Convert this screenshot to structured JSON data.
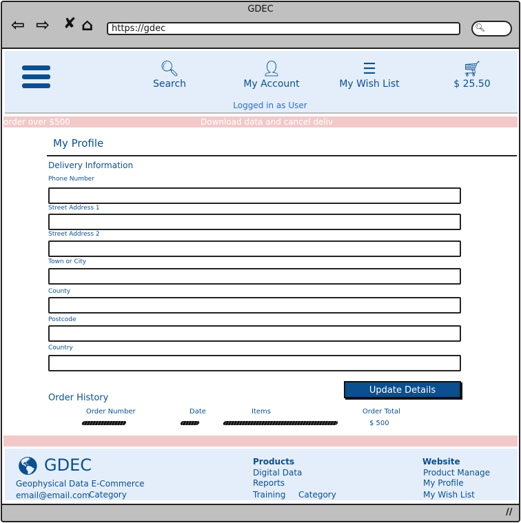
{
  "window": {
    "title": "GDEC",
    "url": "https://gdec"
  },
  "header": {
    "search": "Search",
    "account": "My Account",
    "wishlist": "My Wish List",
    "cart_total": "$ 25.50",
    "logged_in": "Logged in as User"
  },
  "banner": {
    "left": "order over $500",
    "center": "Download data and cancel deliv"
  },
  "profile": {
    "title": "My Profile",
    "section": "Delivery Information",
    "fields": [
      {
        "label": "Phone Number",
        "value": ""
      },
      {
        "label": "Street Address 1",
        "value": ""
      },
      {
        "label": "Street Address 2",
        "value": ""
      },
      {
        "label": "Town or City",
        "value": ""
      },
      {
        "label": "County",
        "value": ""
      },
      {
        "label": "Postcode",
        "value": ""
      },
      {
        "label": "Country",
        "value": ""
      }
    ],
    "update_button": "Update Details"
  },
  "orders": {
    "title": "Order History",
    "columns": [
      "Order Number",
      "Date",
      "Items",
      "Order Total"
    ],
    "rows": [
      {
        "total": "$ 500"
      }
    ]
  },
  "footer": {
    "brand": "GDEC",
    "tagline": "Geophysical Data E-Commerce",
    "email": "email@email.com",
    "category": "Category",
    "products": {
      "title": "Products",
      "items": [
        "Digital Data",
        "Reports",
        "Training"
      ],
      "category": "Category"
    },
    "website": {
      "title": "Website",
      "items": [
        "Product Manage",
        "My Profile",
        "My Wish List"
      ]
    }
  },
  "colors": {
    "brand": "#0a4f8f",
    "header_bg": "#e4eefb",
    "banner": "#f2c9c9",
    "chrome": "#c0c0c0"
  }
}
